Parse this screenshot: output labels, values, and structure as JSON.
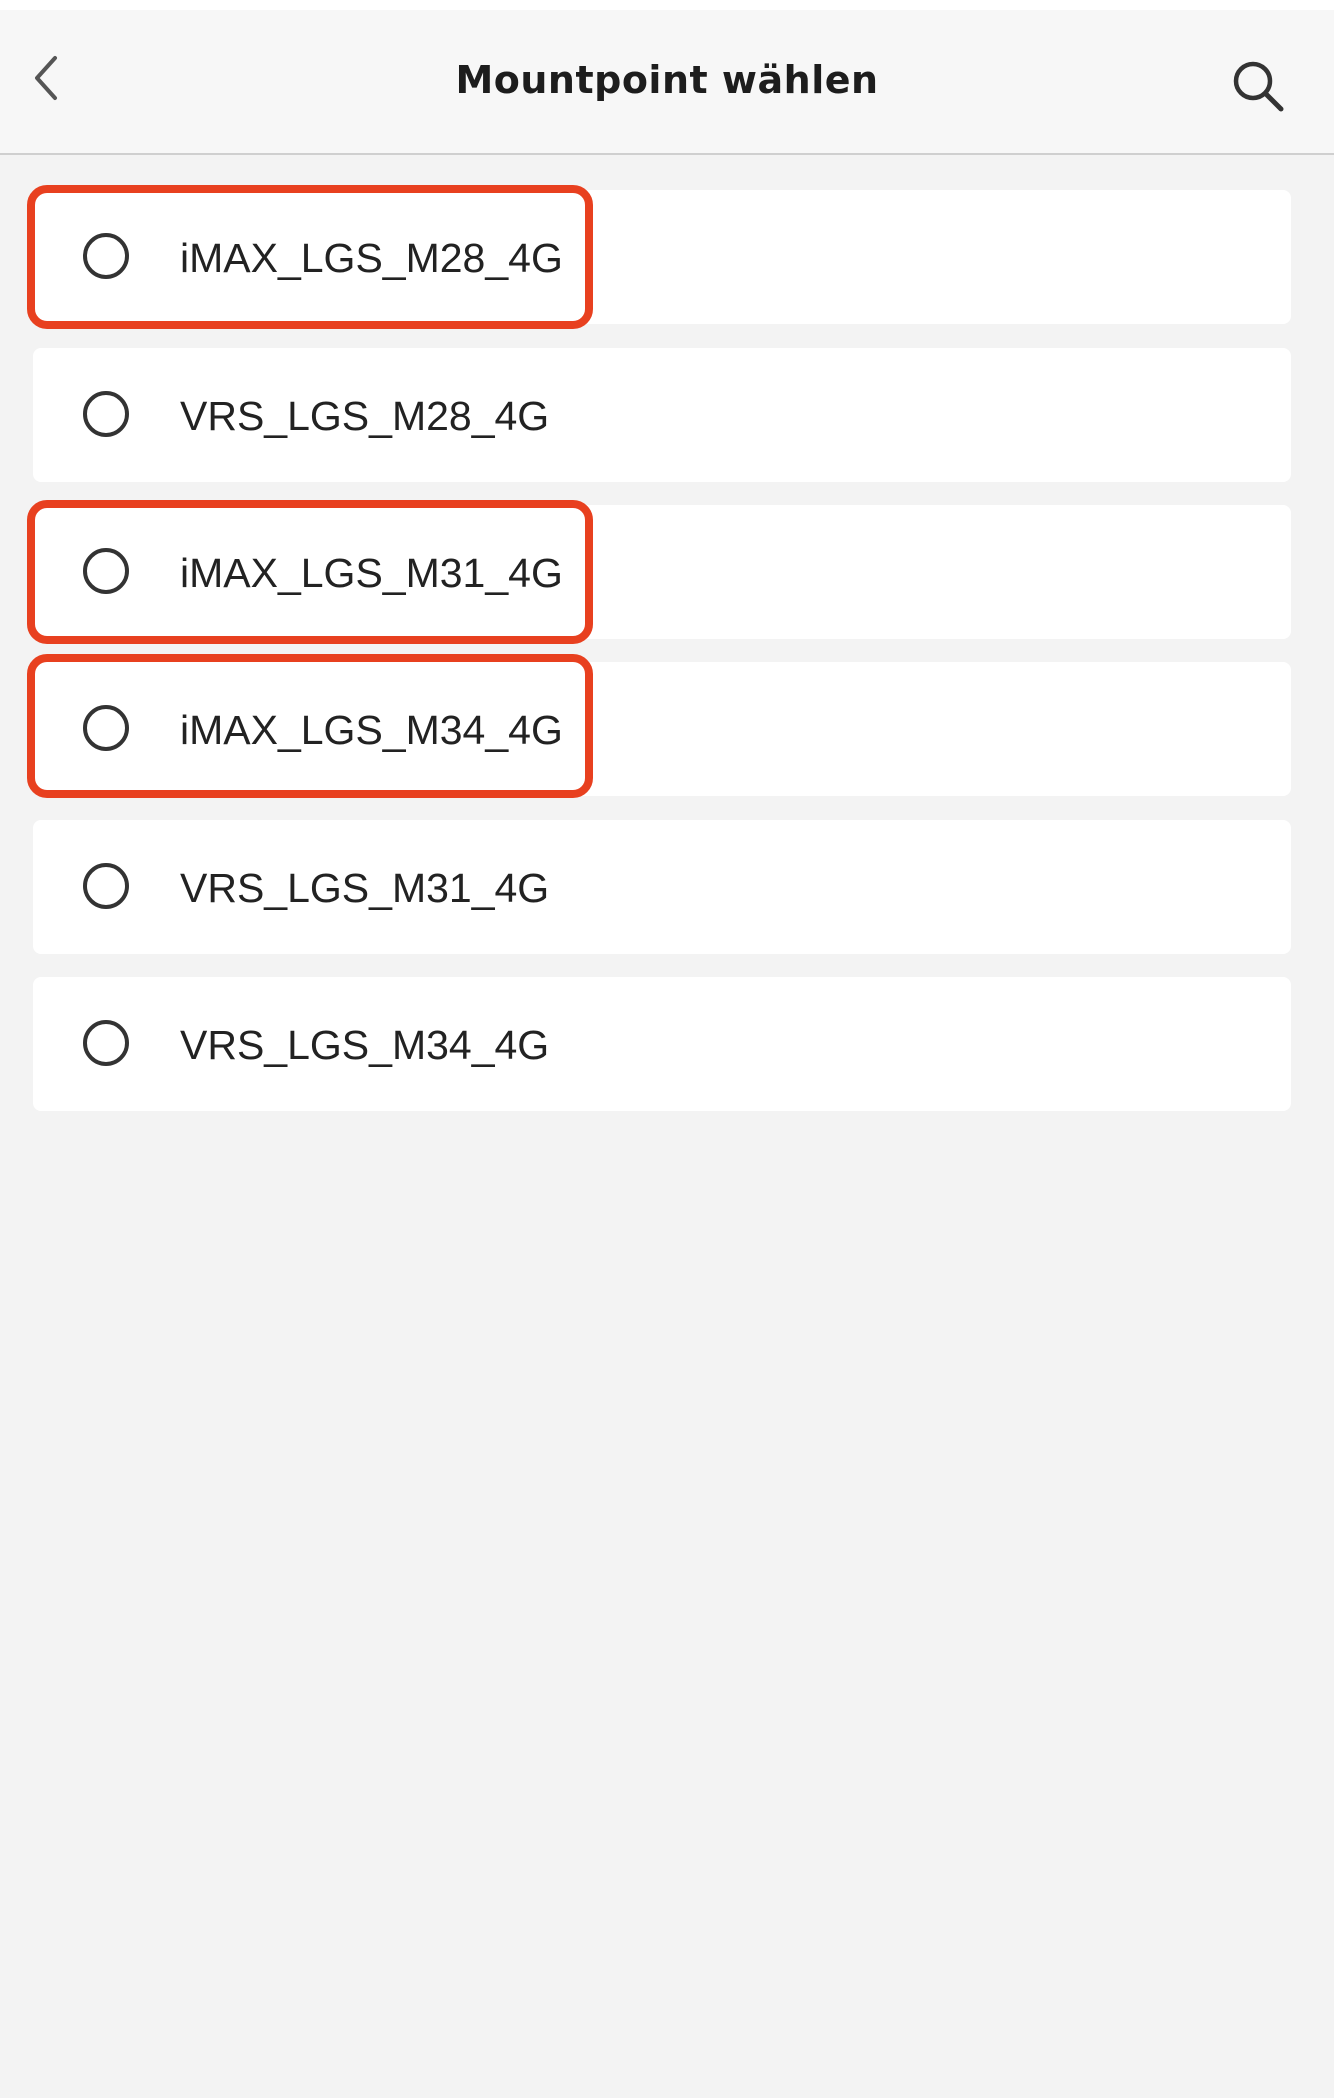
{
  "header": {
    "title": "Mountpoint wählen",
    "back_icon": "chevron-left-icon",
    "search_icon": "search-icon"
  },
  "mountpoints": [
    {
      "label": "iMAX_LGS_M28_4G",
      "selected": false,
      "highlighted": true
    },
    {
      "label": "VRS_LGS_M28_4G",
      "selected": false,
      "highlighted": false
    },
    {
      "label": "iMAX_LGS_M31_4G",
      "selected": false,
      "highlighted": true
    },
    {
      "label": "iMAX_LGS_M34_4G",
      "selected": false,
      "highlighted": true
    },
    {
      "label": "VRS_LGS_M31_4G",
      "selected": false,
      "highlighted": false
    },
    {
      "label": "VRS_LGS_M34_4G",
      "selected": false,
      "highlighted": false
    }
  ],
  "colors": {
    "highlight": "#e8401f",
    "background": "#f3f3f3",
    "item_background": "#ffffff"
  }
}
